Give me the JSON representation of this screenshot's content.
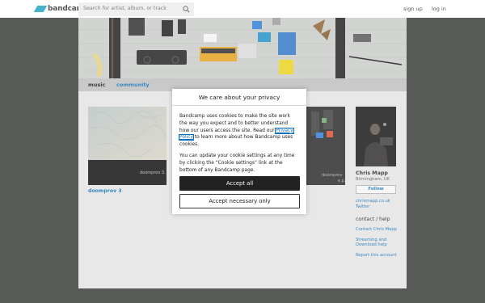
{
  "header": {
    "logo_text": "bandcamp",
    "search_placeholder": "Search for artist, album, or track",
    "signup_label": "sign up",
    "login_label": "log in"
  },
  "nav": {
    "tabs": [
      {
        "label": "music",
        "active": true
      },
      {
        "label": "community",
        "active": false
      }
    ]
  },
  "albums": [
    {
      "title": "doomprov 3",
      "cover_caption": "doomprov 3."
    },
    {
      "title": "",
      "cover_caption": "doomprov\ne.p."
    }
  ],
  "artist": {
    "name": "Chris Mapp",
    "location": "Birmingham, UK",
    "follow_label": "Follow",
    "links": [
      "chrismapp.co.uk",
      "Twitter"
    ],
    "contact_heading": "contact / help",
    "help_links": [
      "Contact Chris Mapp",
      "Streaming and Download help",
      "Report this account"
    ]
  },
  "cookie_modal": {
    "title": "We care about your privacy",
    "para1_before": "Bandcamp uses cookies to make the site work the way you expect and to better understand how our users access the site. Read our ",
    "privacy_link": "Privacy Policy",
    "para1_after": " to learn more about how Bandcamp uses cookies.",
    "para2": "You can update your cookie settings at any time by clicking the “Cookie settings” link at the bottom of any Bandcamp page.",
    "accept_all_label": "Accept all",
    "accept_necessary_label": "Accept necessary only"
  },
  "colors": {
    "accent": "#0f6fb4",
    "brand": "#1da0c3",
    "page_bg": "#333632"
  }
}
